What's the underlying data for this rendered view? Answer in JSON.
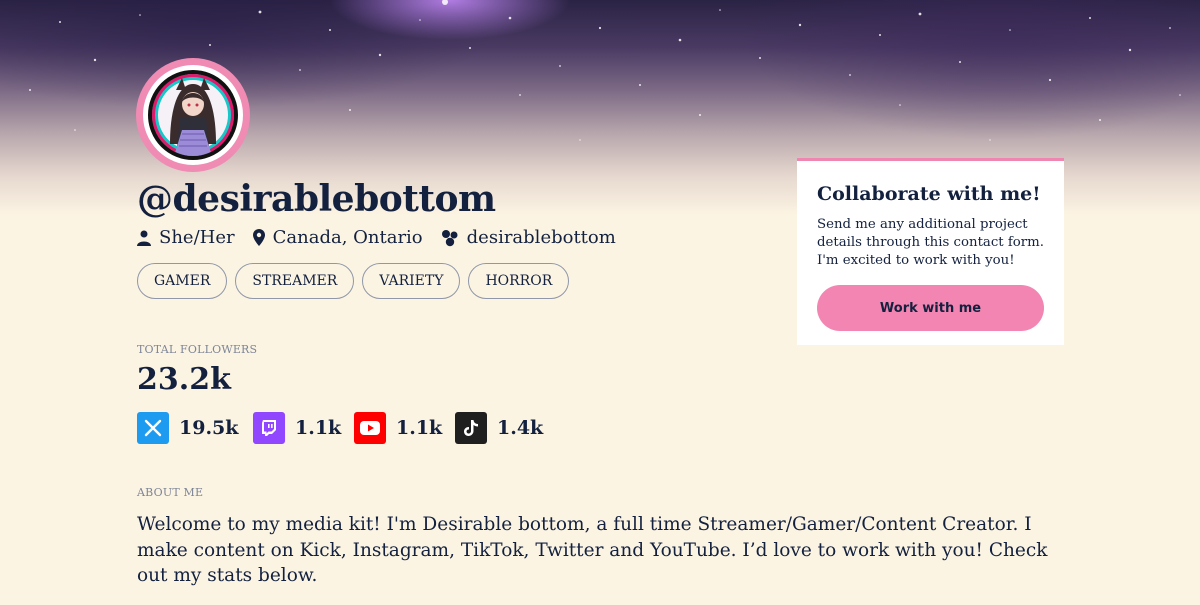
{
  "profile": {
    "handle": "@desirablebottom",
    "pronouns": "She/Her",
    "location": "Canada, Ontario",
    "community": "desirablebottom",
    "tags": [
      "GAMER",
      "STREAMER",
      "VARIETY",
      "HORROR"
    ]
  },
  "stats": {
    "total_label": "TOTAL FOLLOWERS",
    "total": "23.2k",
    "platforms": [
      {
        "name": "X",
        "icon": "x-icon",
        "count": "19.5k",
        "color": "#1d9bf0"
      },
      {
        "name": "Twitch",
        "icon": "twitch-icon",
        "count": "1.1k",
        "color": "#9146ff"
      },
      {
        "name": "YouTube",
        "icon": "youtube-icon",
        "count": "1.1k",
        "color": "#ff0000"
      },
      {
        "name": "TikTok",
        "icon": "tiktok-icon",
        "count": "1.4k",
        "color": "#1f1f1f"
      }
    ]
  },
  "about": {
    "label": "ABOUT ME",
    "text": "Welcome to my media kit! I'm Desirable bottom, a full time Streamer/Gamer/Content Creator. I make content on Kick, Instagram, TikTok, Twitter and YouTube. I’d love to work with you! Check out my stats below."
  },
  "collab": {
    "title": "Collaborate with me!",
    "text": "Send me any additional project details through this contact form. I'm excited to work with you!",
    "button": "Work with me"
  },
  "colors": {
    "accent": "#f285b2",
    "text": "#13213f",
    "background": "#fcf4e3"
  }
}
